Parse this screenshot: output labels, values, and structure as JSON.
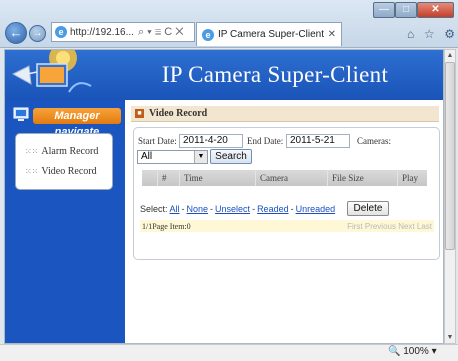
{
  "browser": {
    "address": "http://192.16...",
    "address_controls": "⌕ ▾ ≣ C ✕",
    "tab_title": "IP Camera Super-Client",
    "tab_close": "✕",
    "window_buttons": {
      "minimize": "—",
      "maximize": "□",
      "close": "✕"
    },
    "zoom": "🔍 100%  ▾"
  },
  "app": {
    "title": "IP Camera Super-Client",
    "nav_title": "Manager navigate",
    "nav_items": [
      {
        "label": "Alarm Record"
      },
      {
        "label": "Video Record"
      }
    ]
  },
  "main": {
    "section_title": "Video Record",
    "form": {
      "start_date_label": "Start Date:",
      "start_date_value": "2011-4-20",
      "end_date_label": "End Date:",
      "end_date_value": "2011-5-21",
      "cameras_label": "Cameras:",
      "camera_selected": "All",
      "search_label": "Search"
    },
    "table": {
      "columns": [
        "",
        "#",
        "Time",
        "Camera",
        "File Size",
        "Play"
      ]
    },
    "selection": {
      "prefix": "Select:",
      "links": [
        "All",
        "None",
        "Unselect",
        "Readed",
        "Unreaded"
      ],
      "delete_label": "Delete"
    },
    "pager": {
      "info": "1/1Page Item:0",
      "nav": "First Previous Next Last"
    }
  }
}
